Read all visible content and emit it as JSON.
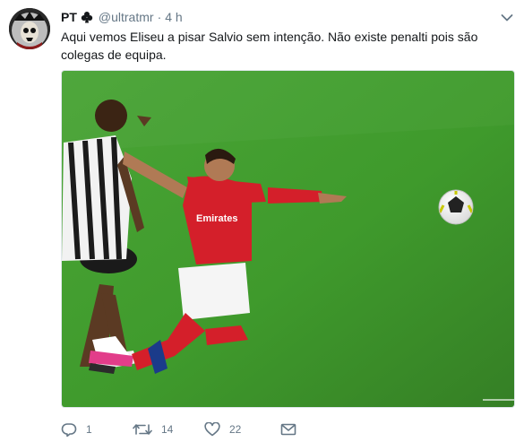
{
  "tweet": {
    "display_name": "PT",
    "name_icon": "club-suit-icon",
    "handle": "@ultratmr",
    "separator": "·",
    "time": "4 h",
    "text": "Aqui vemos Eliseu a pisar Salvio sem intenção. Não existe penalti pois são colegas de equipa.",
    "media_kit_text": "Emirates",
    "actions": {
      "reply_count": "1",
      "retweet_count": "14",
      "like_count": "22"
    }
  },
  "colors": {
    "text": "#14171a",
    "muted": "#657786",
    "pitch": "#3f9a2c",
    "red_kit": "#d41f2a"
  }
}
